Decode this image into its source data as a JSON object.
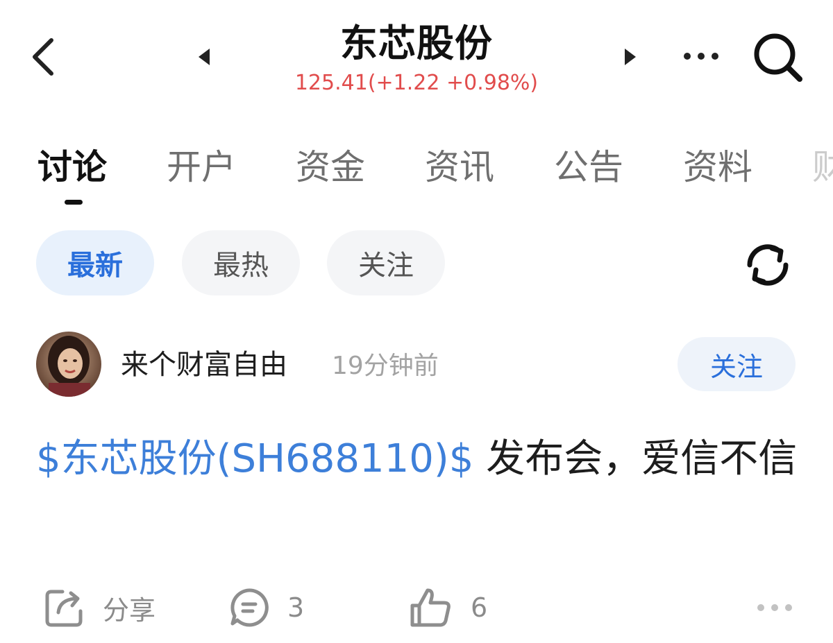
{
  "header": {
    "stock_name": "东芯股份",
    "price_line": "125.41(+1.22 +0.98%)",
    "price_color": "#e14c4c",
    "icons": {
      "back": "chevron-left-icon",
      "prev": "triangle-left-icon",
      "next": "triangle-right-icon",
      "more": "more-dots-icon",
      "search": "search-icon"
    }
  },
  "tabs": [
    {
      "label": "讨论",
      "active": true
    },
    {
      "label": "开户",
      "active": false
    },
    {
      "label": "资金",
      "active": false
    },
    {
      "label": "资讯",
      "active": false
    },
    {
      "label": "公告",
      "active": false
    },
    {
      "label": "资料",
      "active": false
    },
    {
      "label": "财",
      "active": false
    }
  ],
  "filters": {
    "items": [
      {
        "label": "最新",
        "active": true
      },
      {
        "label": "最热",
        "active": false
      },
      {
        "label": "关注",
        "active": false
      }
    ],
    "refresh_icon": "refresh-icon"
  },
  "post": {
    "author": "来个财富自由",
    "time": "19分钟前",
    "follow_label": "关注",
    "stock_tag": "$东芯股份(SH688110)$",
    "text": " 发布会，爱信不信",
    "actions": {
      "share_label": "分享",
      "comment_count": "3",
      "like_count": "6"
    }
  },
  "colors": {
    "accent_blue": "#2a6fdb",
    "link_blue": "#3d7fd9",
    "price_red": "#e14c4c"
  }
}
